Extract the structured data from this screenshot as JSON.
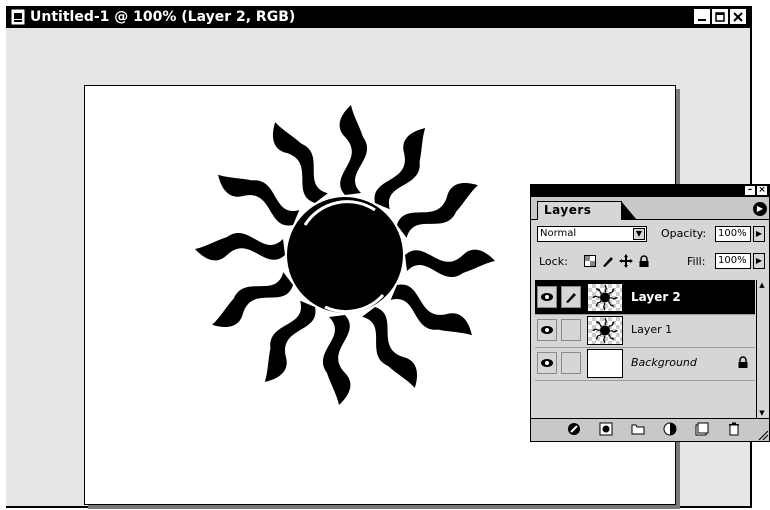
{
  "window": {
    "title": "Untitled-1 @ 100% (Layer 2, RGB)",
    "buttons": [
      "minimize",
      "maximize",
      "close"
    ]
  },
  "layers_panel": {
    "tab_label": "Layers",
    "blend_mode": "Normal",
    "opacity_label": "Opacity:",
    "opacity_value": "100%",
    "lock_label": "Lock:",
    "fill_label": "Fill:",
    "fill_value": "100%",
    "layers": [
      {
        "name": "Layer 2",
        "selected": true,
        "visible": true,
        "thumbnail": "sun-shape"
      },
      {
        "name": "Layer 1",
        "selected": false,
        "visible": true,
        "thumbnail": "sun-shape"
      },
      {
        "name": "Background",
        "selected": false,
        "visible": true,
        "thumbnail": "white",
        "locked": true
      }
    ],
    "bottom_icons": [
      "add-style-icon",
      "add-mask-icon",
      "new-set-icon",
      "new-fill-layer-icon",
      "new-layer-icon",
      "trash-icon"
    ]
  }
}
